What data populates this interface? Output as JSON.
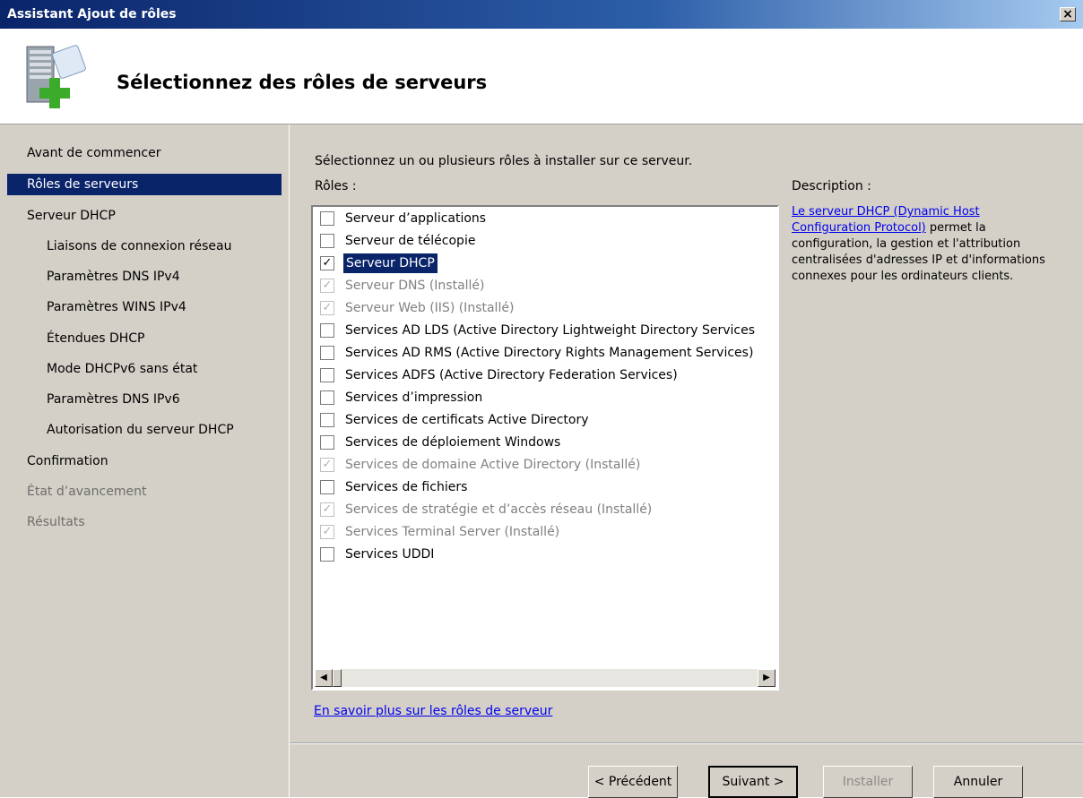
{
  "window": {
    "title": "Assistant Ajout de rôles",
    "close_glyph": "×"
  },
  "header": {
    "heading": "Sélectionnez des rôles de serveurs",
    "icon": "server-add-icon"
  },
  "sidebar": {
    "items": [
      {
        "label": "Avant de commencer",
        "state": "normal",
        "level": 0
      },
      {
        "label": "Rôles de serveurs",
        "state": "selected",
        "level": 0
      },
      {
        "label": "Serveur DHCP",
        "state": "normal",
        "level": 0
      },
      {
        "label": "Liaisons de connexion réseau",
        "state": "normal",
        "level": 1
      },
      {
        "label": "Paramètres DNS IPv4",
        "state": "normal",
        "level": 1
      },
      {
        "label": "Paramètres WINS IPv4",
        "state": "normal",
        "level": 1
      },
      {
        "label": "Étendues DHCP",
        "state": "normal",
        "level": 1
      },
      {
        "label": "Mode DHCPv6 sans état",
        "state": "normal",
        "level": 1
      },
      {
        "label": "Paramètres DNS IPv6",
        "state": "normal",
        "level": 1
      },
      {
        "label": "Autorisation du serveur DHCP",
        "state": "normal",
        "level": 1
      },
      {
        "label": "Confirmation",
        "state": "normal",
        "level": 0
      },
      {
        "label": "État d’avancement",
        "state": "disabled",
        "level": 0
      },
      {
        "label": "Résultats",
        "state": "disabled",
        "level": 0
      }
    ]
  },
  "main": {
    "instruction": "Sélectionnez un ou plusieurs rôles à installer sur ce serveur.",
    "roles_label": "Rôles :",
    "description_label": "Description :",
    "description_link": "Le serveur DHCP (Dynamic Host Configuration Protocol)",
    "description_text": " permet la configuration, la gestion et l'attribution centralisées d'adresses IP et d'informations connexes pour les ordinateurs clients.",
    "roles": [
      {
        "label": "Serveur d’applications",
        "checked": false,
        "installed": false,
        "selected": false
      },
      {
        "label": "Serveur de télécopie",
        "checked": false,
        "installed": false,
        "selected": false
      },
      {
        "label": "Serveur DHCP",
        "checked": true,
        "installed": false,
        "selected": true
      },
      {
        "label": "Serveur DNS  (Installé)",
        "checked": true,
        "installed": true,
        "selected": false
      },
      {
        "label": "Serveur Web (IIS)  (Installé)",
        "checked": true,
        "installed": true,
        "selected": false
      },
      {
        "label": "Services AD LDS (Active Directory Lightweight Directory Services",
        "checked": false,
        "installed": false,
        "selected": false
      },
      {
        "label": "Services AD RMS (Active Directory Rights Management Services)",
        "checked": false,
        "installed": false,
        "selected": false
      },
      {
        "label": "Services ADFS (Active Directory Federation Services)",
        "checked": false,
        "installed": false,
        "selected": false
      },
      {
        "label": "Services d’impression",
        "checked": false,
        "installed": false,
        "selected": false
      },
      {
        "label": "Services de certificats Active Directory",
        "checked": false,
        "installed": false,
        "selected": false
      },
      {
        "label": "Services de déploiement Windows",
        "checked": false,
        "installed": false,
        "selected": false
      },
      {
        "label": "Services de domaine Active Directory  (Installé)",
        "checked": true,
        "installed": true,
        "selected": false
      },
      {
        "label": "Services de fichiers",
        "checked": false,
        "installed": false,
        "selected": false
      },
      {
        "label": "Services de stratégie et d’accès réseau  (Installé)",
        "checked": true,
        "installed": true,
        "selected": false
      },
      {
        "label": "Services Terminal Server  (Installé)",
        "checked": true,
        "installed": true,
        "selected": false
      },
      {
        "label": "Services UDDI",
        "checked": false,
        "installed": false,
        "selected": false
      }
    ],
    "scroll_left_glyph": "◀",
    "scroll_right_glyph": "▶",
    "more_link": "En savoir plus sur les rôles de serveur"
  },
  "buttons": {
    "previous": "< Précédent",
    "next": "Suivant >",
    "install": "Installer",
    "cancel": "Annuler"
  },
  "colors": {
    "selection": "#0a246a",
    "face": "#d4d0c8",
    "link": "#0000ee"
  }
}
